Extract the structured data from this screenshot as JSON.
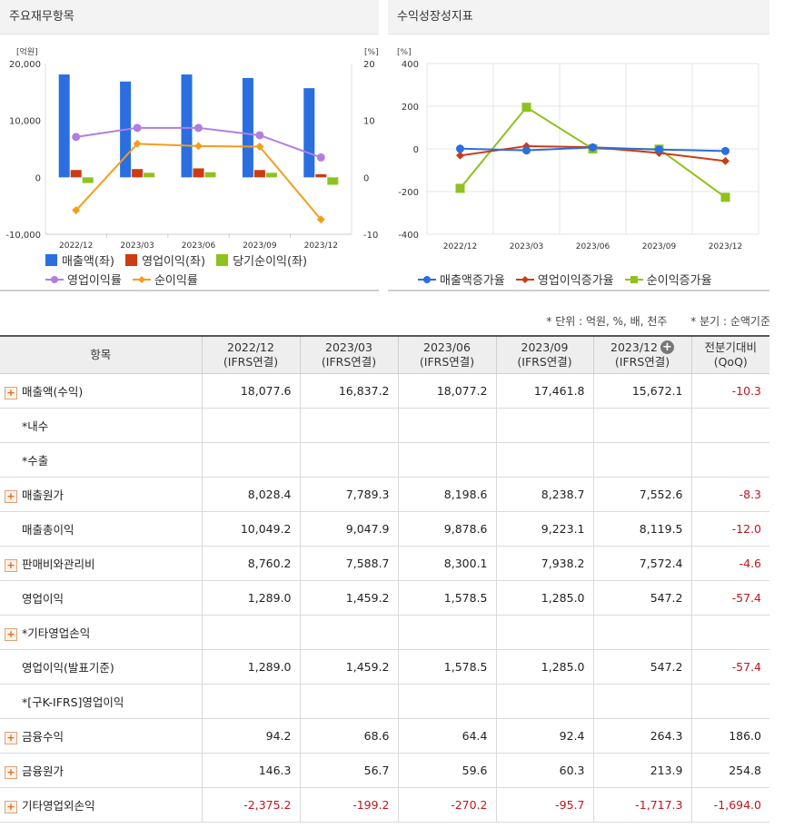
{
  "left_panel": {
    "title": "주요재무항목",
    "y_left_unit": "[억원]",
    "y_right_unit": "[%]",
    "y_left_ticks": [
      "20,000",
      "10,000",
      "0",
      "-10,000"
    ],
    "y_right_ticks": [
      "20",
      "10",
      "0",
      "-10"
    ],
    "legend": [
      "매출액(좌)",
      "영업이익(좌)",
      "당기순이익(좌)",
      "영업이익률",
      "순이익률"
    ],
    "colors": {
      "revenue": "#2a6ee0",
      "op_income": "#cc3b12",
      "net_income": "#8ec21f",
      "op_margin": "#b07ee2",
      "net_margin": "#f59d1c"
    }
  },
  "right_panel": {
    "title": "수익성장성지표",
    "y_unit": "[%]",
    "y_ticks": [
      "400",
      "200",
      "0",
      "-200",
      "-400"
    ],
    "legend": [
      "매출액증가율",
      "영업이익증가율",
      "순이익증가율"
    ],
    "colors": {
      "rev_growth": "#2a6ee0",
      "op_growth": "#cc3b12",
      "net_growth": "#8ec21f"
    }
  },
  "chart_data": [
    {
      "type": "bar",
      "categories": [
        "2022/12",
        "2023/03",
        "2023/06",
        "2023/09",
        "2023/12"
      ],
      "ylim": [
        -10000,
        20000
      ],
      "y2lim": [
        -10,
        20
      ],
      "ylabel": "[억원]",
      "y2label": "[%]",
      "series": [
        {
          "name": "매출액(좌)",
          "axis": "left",
          "type": "bar",
          "values": [
            18077.6,
            16837.2,
            18077.2,
            17461.8,
            15672.1
          ]
        },
        {
          "name": "영업이익(좌)",
          "axis": "left",
          "type": "bar",
          "values": [
            1289.0,
            1459.2,
            1578.5,
            1285.0,
            547.2
          ]
        },
        {
          "name": "당기순이익(좌)",
          "axis": "left",
          "type": "bar",
          "values": [
            -1000,
            800,
            900,
            800,
            -1300
          ]
        },
        {
          "name": "영업이익률",
          "axis": "right",
          "type": "line",
          "values": [
            7.1,
            8.7,
            8.7,
            7.4,
            3.5
          ]
        },
        {
          "name": "순이익률",
          "axis": "right",
          "type": "line",
          "values": [
            -5.8,
            5.9,
            5.5,
            5.4,
            -7.4
          ]
        }
      ],
      "grid": false,
      "legend_position": "bottom"
    },
    {
      "type": "line",
      "categories": [
        "2022/12",
        "2023/03",
        "2023/06",
        "2023/09",
        "2023/12"
      ],
      "ylim": [
        -400,
        400
      ],
      "ylabel": "[%]",
      "series": [
        {
          "name": "매출액증가율",
          "values": [
            1,
            -7,
            7,
            -3,
            -10
          ]
        },
        {
          "name": "영업이익증가율",
          "values": [
            -31,
            13,
            8,
            -19,
            -57
          ]
        },
        {
          "name": "순이익증가율",
          "values": [
            -185,
            195,
            0,
            -1,
            -227
          ]
        }
      ],
      "grid": true,
      "legend_position": "bottom"
    }
  ],
  "table": {
    "note_unit": "* 단위 : 억원, %, 배, 천주",
    "note_basis": "* 분기 : 순액기준",
    "header_item": "항목",
    "columns": [
      {
        "period": "2022/12",
        "basis": "(IFRS연결)"
      },
      {
        "period": "2023/03",
        "basis": "(IFRS연결)"
      },
      {
        "period": "2023/06",
        "basis": "(IFRS연결)"
      },
      {
        "period": "2023/09",
        "basis": "(IFRS연결)"
      },
      {
        "period": "2023/12",
        "basis": "(IFRS연결)"
      }
    ],
    "qoq_header": "전분기대비",
    "qoq_sub": "(QoQ)",
    "rows": [
      {
        "label": "매출액(수익)",
        "expand": true,
        "values": [
          "18,077.6",
          "16,837.2",
          "18,077.2",
          "17,461.8",
          "15,672.1"
        ],
        "qoq": "-10.3"
      },
      {
        "label": "*내수",
        "expand": false,
        "values": [
          "",
          "",
          "",
          "",
          ""
        ],
        "qoq": ""
      },
      {
        "label": "*수출",
        "expand": false,
        "values": [
          "",
          "",
          "",
          "",
          ""
        ],
        "qoq": ""
      },
      {
        "label": "매출원가",
        "expand": true,
        "values": [
          "8,028.4",
          "7,789.3",
          "8,198.6",
          "8,238.7",
          "7,552.6"
        ],
        "qoq": "-8.3"
      },
      {
        "label": "매출총이익",
        "expand": false,
        "values": [
          "10,049.2",
          "9,047.9",
          "9,878.6",
          "9,223.1",
          "8,119.5"
        ],
        "qoq": "-12.0"
      },
      {
        "label": "판매비와관리비",
        "expand": true,
        "values": [
          "8,760.2",
          "7,588.7",
          "8,300.1",
          "7,938.2",
          "7,572.4"
        ],
        "qoq": "-4.6"
      },
      {
        "label": "영업이익",
        "expand": false,
        "values": [
          "1,289.0",
          "1,459.2",
          "1,578.5",
          "1,285.0",
          "547.2"
        ],
        "qoq": "-57.4"
      },
      {
        "label": "*기타영업손익",
        "expand": true,
        "values": [
          "",
          "",
          "",
          "",
          ""
        ],
        "qoq": ""
      },
      {
        "label": "영업이익(발표기준)",
        "expand": false,
        "values": [
          "1,289.0",
          "1,459.2",
          "1,578.5",
          "1,285.0",
          "547.2"
        ],
        "qoq": "-57.4"
      },
      {
        "label": "*[구K-IFRS]영업이익",
        "expand": false,
        "values": [
          "",
          "",
          "",
          "",
          ""
        ],
        "qoq": ""
      },
      {
        "label": "금융수익",
        "expand": true,
        "values": [
          "94.2",
          "68.6",
          "64.4",
          "92.4",
          "264.3"
        ],
        "qoq": "186.0"
      },
      {
        "label": "금융원가",
        "expand": true,
        "values": [
          "146.3",
          "56.7",
          "59.6",
          "60.3",
          "213.9"
        ],
        "qoq": "254.8"
      },
      {
        "label": "기타영업외손익",
        "expand": true,
        "values": [
          "-2,375.2",
          "-199.2",
          "-270.2",
          "-95.7",
          "-1,717.3"
        ],
        "qoq": "-1,694.0"
      }
    ]
  }
}
